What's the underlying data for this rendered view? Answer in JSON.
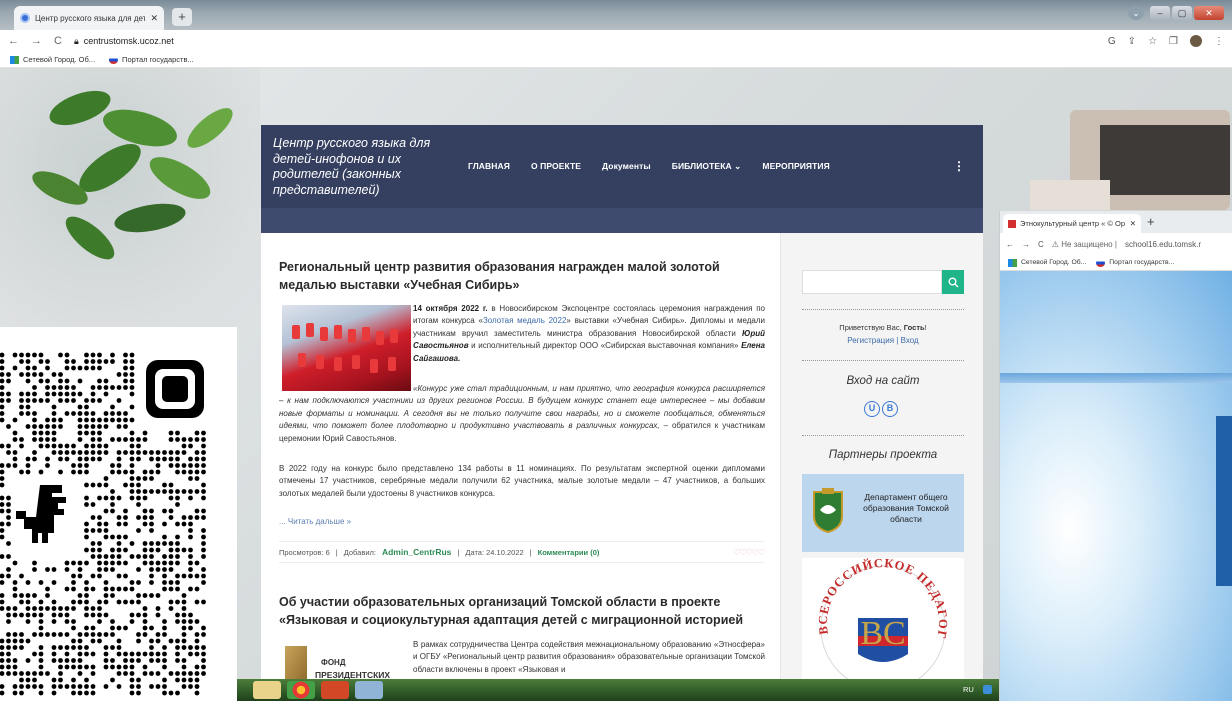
{
  "main_browser": {
    "tab_title": "Центр русского языка для детей-",
    "url": "centrustomsk.ucoz.net",
    "bookmarks": [
      "Сетевой Город. Об...",
      "Портал государств..."
    ]
  },
  "site": {
    "title": "Центр русского языка для детей-инофонов и их родителей (законных представителей)",
    "nav": [
      "ГЛАВНАЯ",
      "О ПРОЕКТЕ",
      "Документы",
      "БИБЛИОТЕКА ⌄",
      "МЕРОПРИЯТИЯ"
    ],
    "nav_more": "⋮"
  },
  "post1": {
    "title": "Региональный центр развития образования награжден малой золотой медалью выставки «Учебная Сибирь»",
    "intro_date": "14 октября 2022 г.",
    "intro_1": " в Новосибирском Экспоцентре состоялась церемония награждения по итогам конкурса «",
    "intro_link": "Золотая медаль 2022",
    "intro_2": "» выставки «Учебная Сибирь». Дипломы и медали участникам вручил заместитель министра образования Новосибирской области ",
    "intro_name1": "Юрий Савостьянов",
    "intro_3": " и исполнительный директор ООО «Сибирская выставочная компания» ",
    "intro_name2": "Елена Сайгашова.",
    "quote_italic": "«Конкурс уже стал традиционным, и нам приятно, что география конкурса расширяется – к нам подключаются участники из других регионов России. В будущем конкурс станет еще интереснее – мы добавим новые форматы и номинации. А сегодня вы не только получите свои награды, но и сможете пообщаться, обменяться идеями, что поможет более плодотворно и продуктивно участвовать в различных конкурсах,",
    "quote_tail": " – обратился к участникам церемонии Юрий Савостьянов.",
    "para3": "В 2022 году на конкурс было представлено 134 работы в 11 номинациях. По результатам экспертной оценки дипломами отмечены 17 участников, серебряные медали получили 62 участника, малые золотые медали – 47 участников, а больших золотых медалей были удостоены 8 участников конкурса.",
    "read_more": "... Читать дальше »",
    "views": "Просмотров: 6",
    "added_by": "Добавил:",
    "author": "Admin_CentrRus",
    "date": "Дата: 24.10.2022",
    "comments": "Комментарии (0)",
    "rating": "♡♡♡♡♡"
  },
  "post2": {
    "title": "Об участии образовательных организаций Томской области в проекте «Языковая и социокультурная адаптация детей с миграционной историей",
    "text": "В рамках сотрудничества Центра содействия межнациональному образованию «Этносфера» и ОГБУ «Региональный центр развития образования» образовательные организации Томской области включены в проект «Языковая и",
    "logo_line1": "ФОНД",
    "logo_line2": "ПРЕЗИДЕНТСКИХ"
  },
  "sidebar": {
    "greeting_prefix": "Приветствую Вас, ",
    "greeting_guest": "Гость",
    "greeting_suffix": "!",
    "register": "Регистрация",
    "separator": " | ",
    "login": "Вход",
    "login_title": "Вход на сайт",
    "login_icons": [
      "U",
      "B"
    ],
    "partners_title": "Партнеры проекта",
    "dep_banner_text": "Департамент общего образования Томской области",
    "vps_text": "ВСЕРОССИЙСКОЕ ПЕДАГОГИЧЕСКОЕ СОБРАНИЕ"
  },
  "second_browser": {
    "tab_title": "Этнокультурный центр « © Ор",
    "security": "Не защищено",
    "url": "school16.edu.tomsk.r",
    "bookmarks": [
      "Сетевой Город. Об...",
      "Портал государств..."
    ]
  },
  "taskbar": {
    "lang": "RU"
  }
}
